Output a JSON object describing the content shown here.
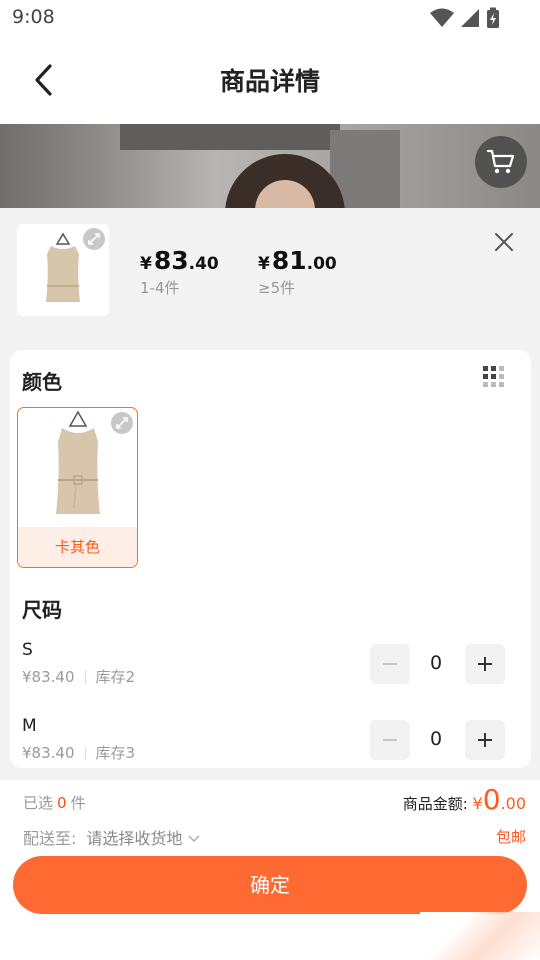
{
  "status_bar": {
    "time": "9:08"
  },
  "header": {
    "title": "商品详情"
  },
  "colors": {
    "accent": "#ff6a33",
    "accent_text": "#ff5a1f",
    "swatch_bg": "#fdeee6",
    "sheet_bg": "#f3f3f3"
  },
  "icons": [
    "back-arrow-icon",
    "wifi-icon",
    "signal-icon",
    "battery-icon",
    "cart-icon",
    "expand-icon",
    "close-icon",
    "grid-icon",
    "minus-icon",
    "plus-icon",
    "chevron-down-icon"
  ],
  "price_tiers": [
    {
      "currency": "¥",
      "integer": "83",
      "decimal": ".40",
      "range": "1-4件"
    },
    {
      "currency": "¥",
      "integer": "81",
      "decimal": ".00",
      "range": "≥5件"
    }
  ],
  "color_section": {
    "title": "颜色",
    "options": [
      {
        "label": "卡其色",
        "selected": true
      }
    ]
  },
  "size_section": {
    "title": "尺码",
    "sizes": [
      {
        "name": "S",
        "price": "¥83.40",
        "stock": "库存2",
        "qty": "0"
      },
      {
        "name": "M",
        "price": "¥83.40",
        "stock": "库存3",
        "qty": "0"
      }
    ]
  },
  "footer": {
    "selected_prefix": "已选",
    "selected_count": "0",
    "selected_suffix": "件",
    "total_label": "商品金额:",
    "total_currency": "¥",
    "total_integer": "0",
    "total_decimal": ".00",
    "ship_label": "配送至:",
    "ship_placeholder": "请选择收货地",
    "free_shipping": "包邮",
    "confirm_label": "确定"
  }
}
